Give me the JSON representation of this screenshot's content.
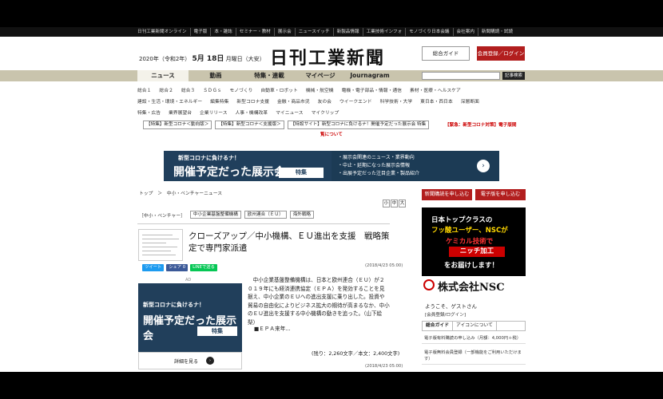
{
  "topnav": [
    "日刊工業新聞オンライン",
    "電子版",
    "本・雑誌",
    "セミナー・教材",
    "展示会",
    "ニュースイッチ",
    "新製品情報",
    "工業技術インフォ",
    "モノづくり日本会議",
    "会社案内",
    "新聞購読・試読"
  ],
  "header": {
    "date_prefix": "2020年（令和2年）",
    "month_day": "5月 18日",
    "weekday": "月曜日（大安）",
    "logo": "日刊工業新聞",
    "guide": "総合ガイド",
    "login": "会員登録／ログイン"
  },
  "mainnav": [
    "ニュース",
    "動画",
    "特集・連載",
    "マイページ",
    "Journagram"
  ],
  "search": {
    "button": "記事検索"
  },
  "categories": [
    [
      "総合１",
      "総合２",
      "総合３",
      "ＳＤＧｓ",
      "モノづくり",
      "自動車・ロボット",
      "機械・航空機",
      "電機・電子部品・情報・通信",
      "素材・医療・ヘルスケア"
    ],
    [
      "建設・生活・環境・エネルギー",
      "編集特集",
      "新型コロナ支援",
      "金融・商品市況",
      "友の会",
      "ウイークエンド",
      "科学技術・大学",
      "東日本・西日本",
      "深層断面"
    ],
    [
      "特集・広告",
      "業界展望台",
      "企業リリース",
      "人事・機構改革",
      "マイニュース",
      "マイクリップ"
    ]
  ],
  "pills": [
    "【特集】新型コロナ＜動向版＞",
    "【特集】新型コロナ＜支援版＞",
    "【特設サイト】新型コロナに負けるナ！開催予定だった展示会 特集"
  ],
  "pill_red": "【緊急：新型コロナ対策】電子版閲",
  "pill_red2": "覧について",
  "banner": {
    "sub": "新型コロナに負けるナ！",
    "title": "開催予定だった展示会",
    "tag": "特集",
    "bullets": [
      "・展示会関連のニュース・業界動向",
      "・中止・延期になった展示会情報",
      "・出展予定だった注目企業・製品紹介"
    ],
    "arrow": "›"
  },
  "breadcrumb": "トップ　＞　中小・ベンチャーニュース",
  "fontsize": [
    "小",
    "中",
    "大"
  ],
  "article": {
    "category": "［中小・ベンチャー］",
    "tags": [
      "中小企業基盤整備機構",
      "欧州連合（ＥＵ）",
      "海外戦略"
    ],
    "title": "クローズアップ／中小機構、ＥＵ進出を支援　戦略策定で専門家派遣",
    "date": "(2018/4/23 05:00)",
    "body": "中小企業基盤整備機構は、日本と欧州連合（ＥＵ）が２０１９年にも経済連携協定（ＥＰＡ）を発効することを見据え、中小企業のＥＵへの進出支援に乗り出した。投資や貿易の自由化によりビジネス拡大の期待が高まるなか、中小のＥＵ進出を支援する中小機構の動きを追った。（山下絵梨）",
    "section": "■ＥＰＡ来年...",
    "count": "(残り：2,260文字／本文：2,400文字)",
    "date2": "(2018/4/23 05:00)"
  },
  "social": [
    "ツイート",
    "シェア 0",
    "LINEで送る"
  ],
  "ad": {
    "label": "AD",
    "t1": "新型コロナに負けるナ！",
    "t2": "開催予定だった展示会",
    "t3": "特集",
    "foot": "詳細を見る",
    "foot_icon": "›"
  },
  "sidebar": {
    "btn1": "新聞購読を申し込む",
    "btn2": "電子版を申し込む",
    "ad_lines": [
      "日本トップクラスの",
      "フッ酸ユーザー、NSCが",
      "ケミカル技術で",
      "ニッチ加工",
      "をお届けします！"
    ],
    "nsc": "株式会社NSC",
    "welcome": "ようこそ、ゲストさん",
    "guest_info": "[会員登録/ログイン]",
    "tabs": [
      "総合ガイド",
      "アイコンについて"
    ],
    "rows": [
      "電子版有料購読の申し込み（月額：4,000円＋税）",
      "電子版無料会員登録（一部機能をご利用いただけます）"
    ]
  }
}
